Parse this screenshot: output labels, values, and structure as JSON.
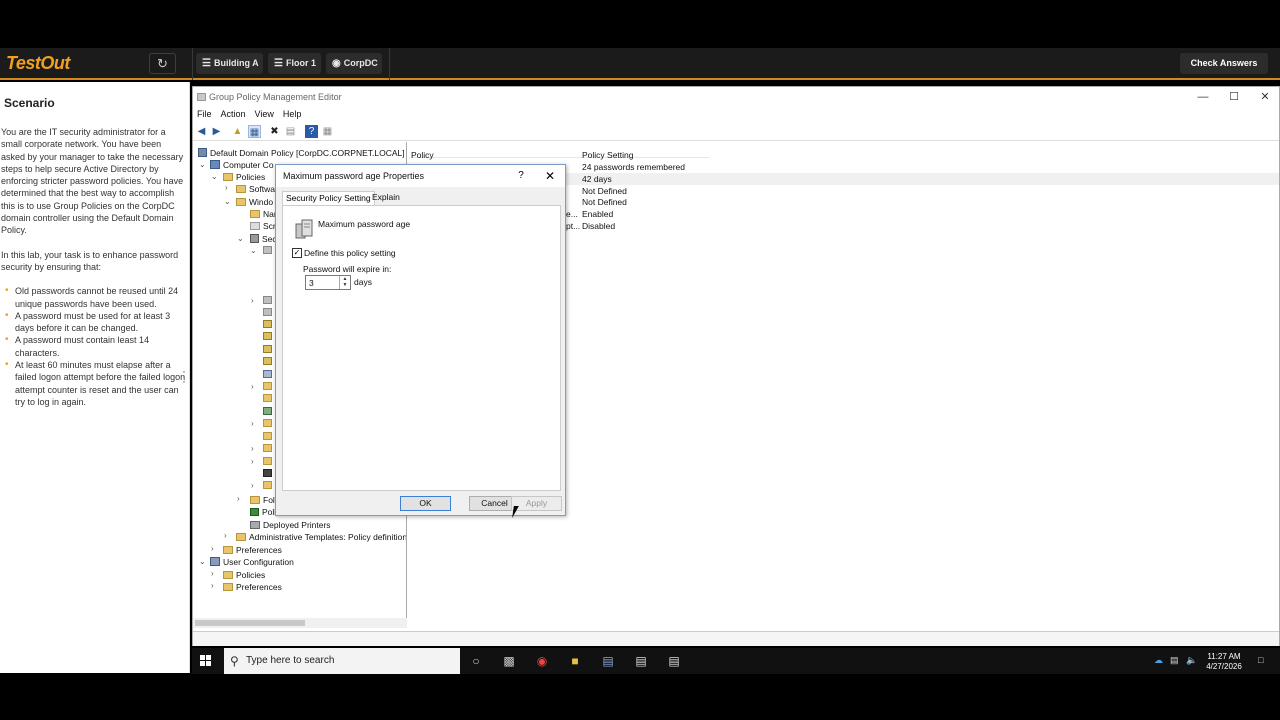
{
  "topbar": {
    "logo": "TestOut",
    "crumbs": [
      "Building A",
      "Floor 1",
      "CorpDC"
    ],
    "check_answers": "Check Answers"
  },
  "scenario": {
    "title": "Scenario",
    "paragraph1": "You are the IT security administrator for a small corporate network. You have been asked by your manager to take the necessary steps to help secure Active Directory by enforcing stricter password policies. You have determined that the best way to accomplish this is to use Group Policies on the CorpDC domain controller using the Default Domain Policy.",
    "paragraph2": "In this lab, your task is to enhance password security by ensuring that:",
    "bullets": [
      "Old passwords cannot be reused until 24 unique passwords have been used.",
      "A password must be used for at least 3 days before it can be changed.",
      "A password must contain least 14 characters.",
      "At least 60 minutes must elapse after a failed logon attempt before the failed logon attempt counter is reset and the user can try to log in again."
    ]
  },
  "window": {
    "title": "Group Policy Management Editor",
    "menu": [
      "File",
      "Action",
      "View",
      "Help"
    ],
    "tree": {
      "root": "Default Domain Policy [CorpDC.CORPNET.LOCAL] Polic",
      "computer_config": "Computer Co",
      "policies": "Policies",
      "software": "Softwa",
      "windows": "Windo",
      "name_res": "Nar",
      "scripts": "Scri",
      "security": "Sec",
      "folder_partial": "Fold",
      "policy_qos": "Polic",
      "deployed_printers": "Deployed Printers",
      "admin_templates": "Administrative Templates: Policy definitions",
      "preferences": "Preferences",
      "user_config": "User Configuration",
      "user_policies": "Policies",
      "user_preferences": "Preferences"
    },
    "list": {
      "col_policy": "Policy",
      "col_setting": "Policy Setting",
      "settings": [
        "24 passwords remembered",
        "42 days",
        "Not Defined",
        "Not Defined",
        "Enabled",
        "Disabled"
      ],
      "policy_frag": [
        "e...",
        "pt..."
      ]
    }
  },
  "dialog": {
    "title": "Maximum password age Properties",
    "help": "?",
    "close": "✕",
    "tab_setting": "Security Policy Setting",
    "tab_explain": "Explain",
    "policy_name": "Maximum password age",
    "define_label": "Define this policy setting",
    "define_checked": true,
    "expire_label": "Password will expire in:",
    "expire_value": "3",
    "days": "days",
    "ok": "OK",
    "cancel": "Cancel",
    "apply": "Apply"
  },
  "taskbar": {
    "search_placeholder": "Type here to search",
    "time": "11:27 AM",
    "date": "4/27/2026"
  }
}
